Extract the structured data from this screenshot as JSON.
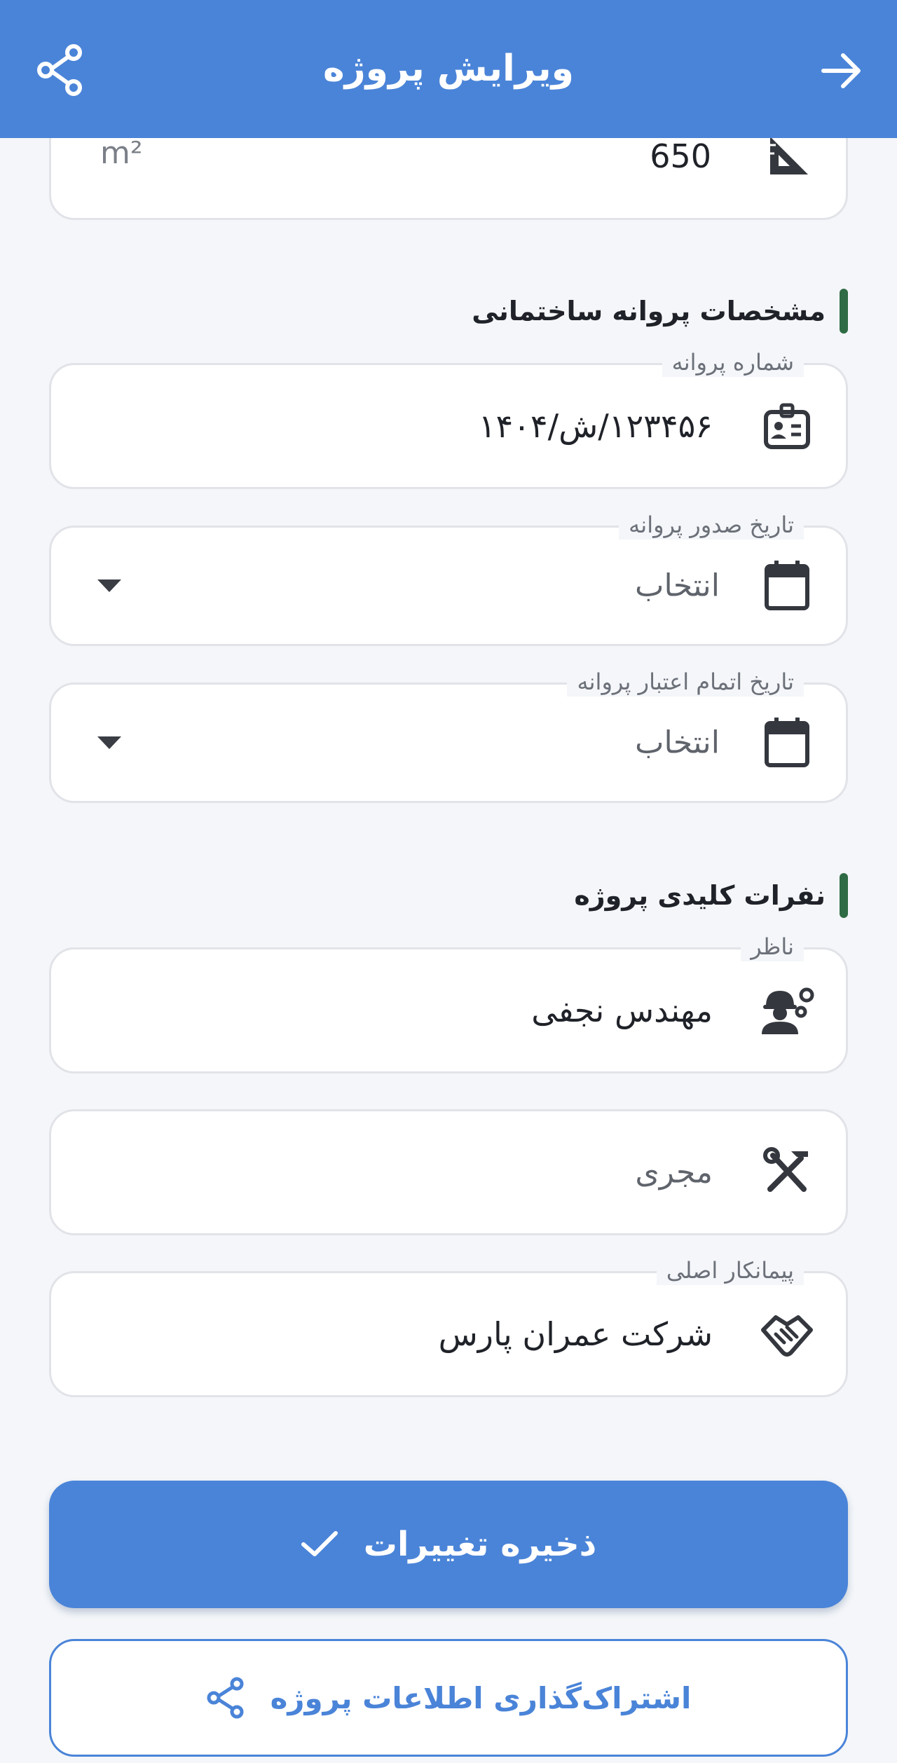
{
  "header": {
    "title": "ویرایش پروژه",
    "back_icon": "arrow-forward-icon",
    "share_icon": "share-icon"
  },
  "area_field": {
    "value": "650",
    "unit": "m²",
    "icon": "ruler-triangle-icon"
  },
  "permit_section": {
    "title": "مشخصات پروانه ساختمانی",
    "number_field": {
      "label": "شماره پروانه",
      "value": "۱۲۳۴۵۶/ش/۱۴۰۴",
      "icon": "id-badge-icon"
    },
    "issue_date_field": {
      "label": "تاریخ صدور پروانه",
      "placeholder": "انتخاب",
      "icon": "calendar-icon"
    },
    "expiry_date_field": {
      "label": "تاریخ اتمام اعتبار پروانه",
      "placeholder": "انتخاب",
      "icon": "calendar-icon"
    }
  },
  "people_section": {
    "title": "نفرات کلیدی پروژه",
    "supervisor_field": {
      "label": "ناظر",
      "value": "مهندس نجفی",
      "icon": "engineer-icon"
    },
    "executor_field": {
      "placeholder": "مجری",
      "icon": "tools-icon"
    },
    "contractor_field": {
      "label": "پیمانکار اصلی",
      "value": "شرکت عمران پارس",
      "icon": "handshake-icon"
    }
  },
  "actions": {
    "save_label": "ذخیره تغییرات",
    "share_label": "اشتراک‌گذاری اطلاعات پروژه"
  },
  "colors": {
    "primary": "#4a84d8",
    "section_accent": "#2f6b44",
    "background": "#f4f6f9"
  }
}
